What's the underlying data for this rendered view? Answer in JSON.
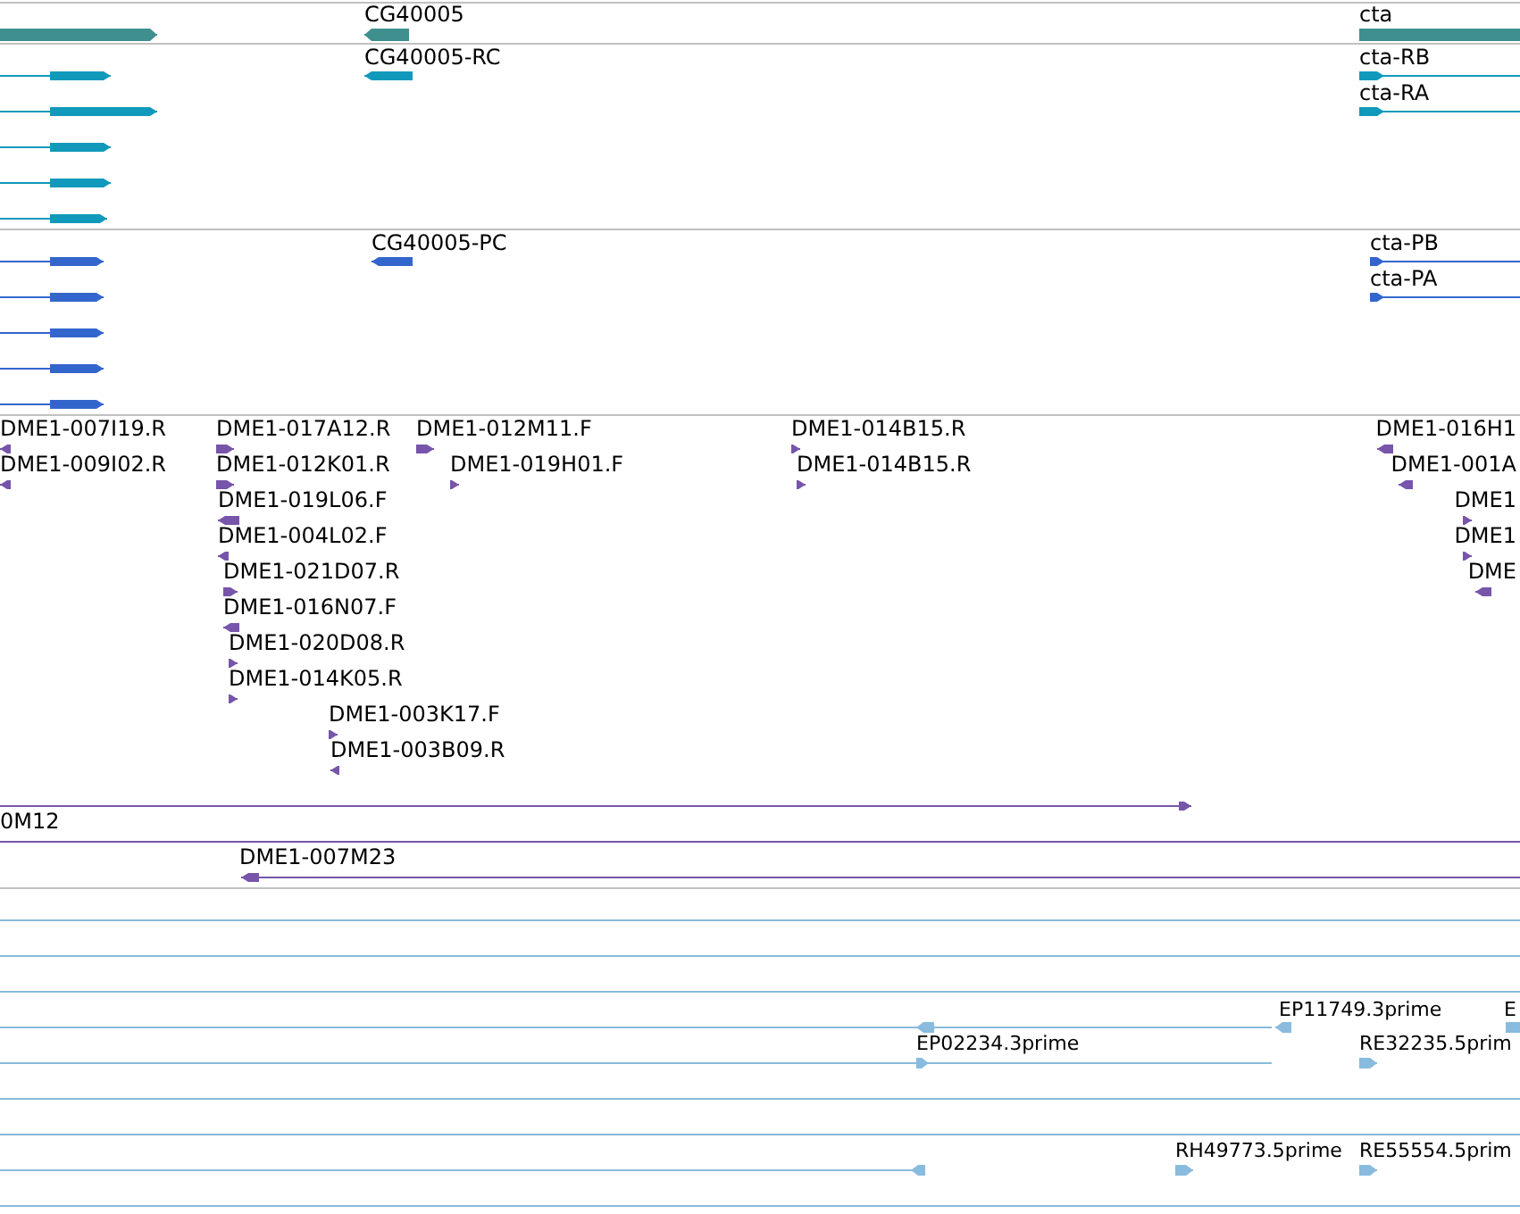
{
  "tracks": [
    {
      "kind": "gene",
      "features": [
        {
          "kind": "arrow",
          "reverse": false
        },
        {
          "kind": "arrow",
          "label": "CG40005",
          "reverse": true
        },
        {
          "kind": "span",
          "label": "cta"
        }
      ]
    },
    {
      "kind": "transcript",
      "features": [
        {
          "kind": "arrow",
          "reverse": false
        },
        {
          "kind": "arrow",
          "reverse": false
        },
        {
          "kind": "arrow",
          "reverse": false
        },
        {
          "kind": "arrow",
          "reverse": false
        },
        {
          "kind": "arrow",
          "reverse": false
        },
        {
          "kind": "arrow",
          "label": "CG40005-RC",
          "reverse": true
        },
        {
          "kind": "arrow",
          "label": "cta-RB",
          "reverse": false
        },
        {
          "kind": "arrow",
          "label": "cta-RA",
          "reverse": false
        }
      ]
    },
    {
      "kind": "protein",
      "features": [
        {
          "kind": "arrow",
          "reverse": false
        },
        {
          "kind": "arrow",
          "reverse": false
        },
        {
          "kind": "arrow",
          "reverse": false
        },
        {
          "kind": "arrow",
          "reverse": false
        },
        {
          "kind": "arrow",
          "reverse": false
        },
        {
          "kind": "arrow",
          "label": "CG40005-PC",
          "reverse": true
        },
        {
          "kind": "arrow",
          "label": "cta-PB",
          "reverse": false
        },
        {
          "kind": "arrow",
          "label": "cta-PA",
          "reverse": false
        }
      ]
    },
    {
      "kind": "clone",
      "features": [
        {
          "kind": "arrow",
          "label": "DME1-007I19.R",
          "reverse": true
        },
        {
          "kind": "arrow",
          "label": "DME1-009I02.R",
          "reverse": true
        },
        {
          "kind": "arrow",
          "label": "DME1-017A12.R",
          "reverse": false
        },
        {
          "kind": "arrow",
          "label": "DME1-012K01.R",
          "reverse": false
        },
        {
          "kind": "arrow",
          "label": "DME1-019L06.F",
          "reverse": true
        },
        {
          "kind": "arrow",
          "label": "DME1-004L02.F",
          "reverse": true
        },
        {
          "kind": "arrow",
          "label": "DME1-021D07.R",
          "reverse": false
        },
        {
          "kind": "arrow",
          "label": "DME1-016N07.F",
          "reverse": true
        },
        {
          "kind": "arrow",
          "label": "DME1-020D08.R",
          "reverse": false
        },
        {
          "kind": "arrow",
          "label": "DME1-014K05.R",
          "reverse": false
        },
        {
          "kind": "arrow",
          "label": "DME1-003K17.F",
          "reverse": false
        },
        {
          "kind": "arrow",
          "label": "DME1-003B09.R",
          "reverse": true
        },
        {
          "kind": "arrow",
          "label": "DME1-012M11.F",
          "reverse": false
        },
        {
          "kind": "arrow",
          "label": "DME1-019H01.F",
          "reverse": false
        },
        {
          "kind": "arrow",
          "label": "DME1-014B15.R",
          "reverse": false
        },
        {
          "kind": "arrow",
          "label": "DME1-014B15.R",
          "reverse": false
        },
        {
          "kind": "arrow",
          "label": "DME1-016H1",
          "reverse": true
        },
        {
          "kind": "arrow",
          "label": "DME1-001A",
          "reverse": true
        },
        {
          "kind": "arrow",
          "label": "DME1",
          "reverse": false
        },
        {
          "kind": "arrow",
          "label": "DME1",
          "reverse": false
        },
        {
          "kind": "arrow",
          "label": "DME",
          "reverse": true
        },
        {
          "kind": "arrow",
          "reverse": false
        },
        {
          "kind": "span",
          "label": "0M12"
        },
        {
          "kind": "arrow",
          "label": "DME1-007M23",
          "reverse": true
        }
      ]
    },
    {
      "kind": "est",
      "features": [
        {
          "kind": "span"
        },
        {
          "kind": "span"
        },
        {
          "kind": "span"
        },
        {
          "kind": "arrow",
          "reverse": true
        },
        {
          "kind": "arrow",
          "label": "EP11749.3prime",
          "reverse": true
        },
        {
          "kind": "arrow",
          "label": "E",
          "reverse": false
        },
        {
          "kind": "arrow",
          "label": "EP02234.3prime",
          "reverse": false
        },
        {
          "kind": "arrow",
          "label": "RE32235.5prim",
          "reverse": false
        },
        {
          "kind": "span"
        },
        {
          "kind": "span"
        },
        {
          "kind": "arrow",
          "reverse": true
        },
        {
          "kind": "arrow",
          "label": "RH49773.5prime",
          "reverse": false
        },
        {
          "kind": "arrow",
          "label": "RE55554.5prim",
          "reverse": false
        },
        {
          "kind": "span"
        }
      ]
    }
  ]
}
